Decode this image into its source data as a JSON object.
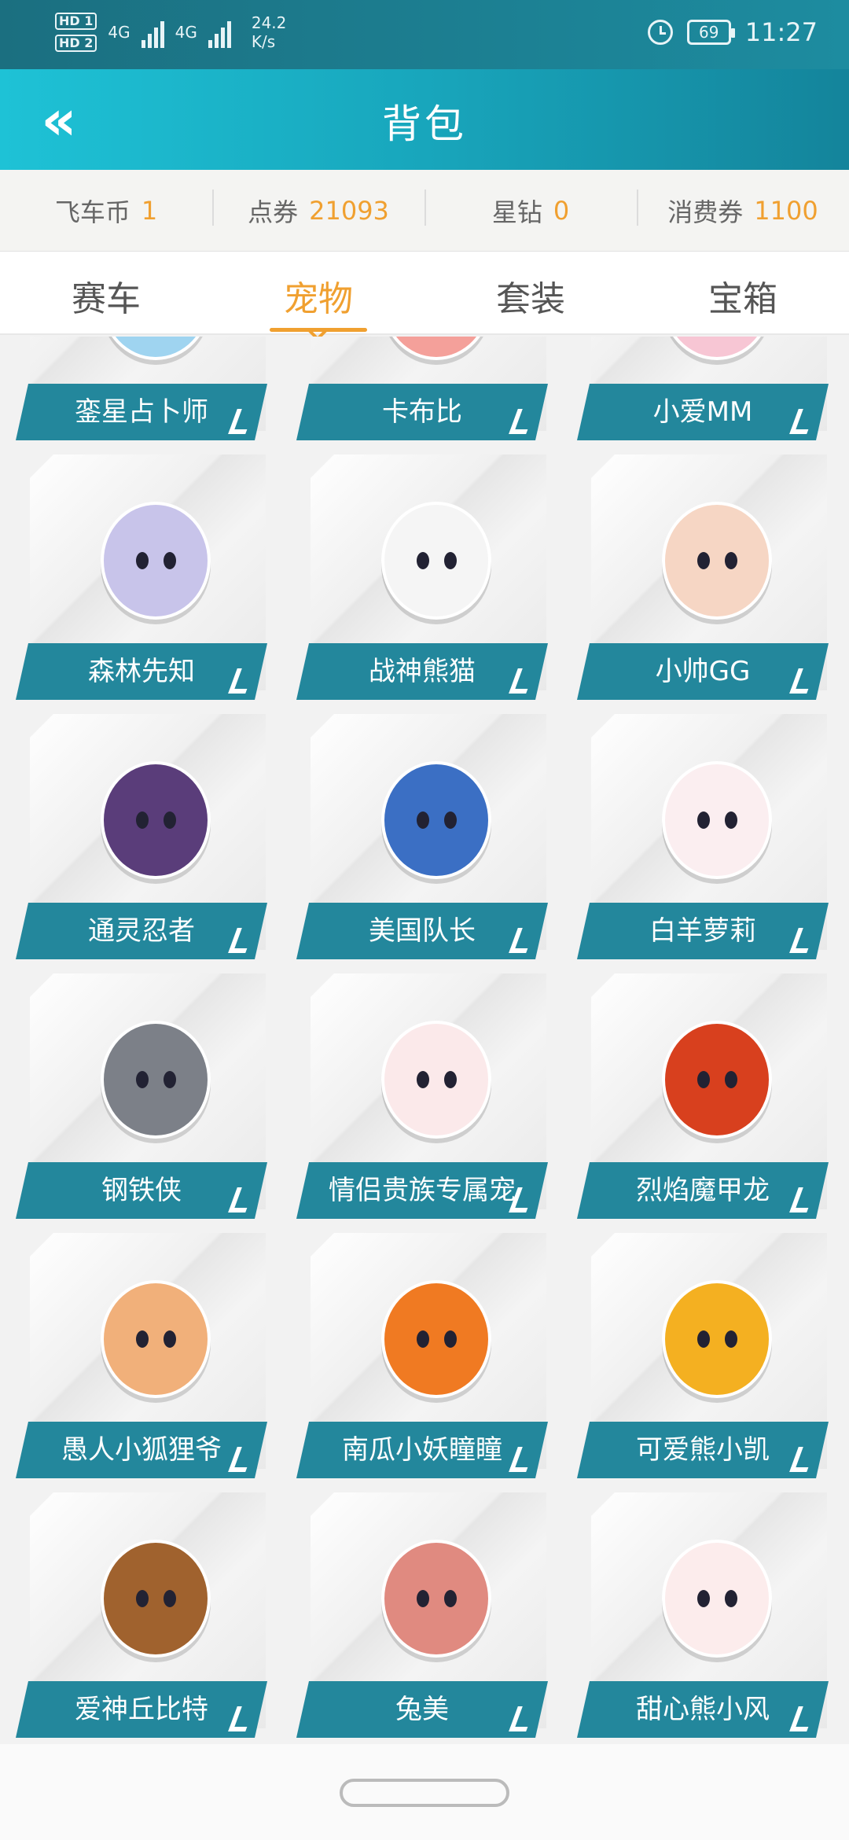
{
  "status": {
    "hd1": "HD 1",
    "hd2": "HD 2",
    "net1": "4G",
    "net2": "4G",
    "speed_value": "24.2",
    "speed_unit": "K/s",
    "battery": "69",
    "time": "11:27"
  },
  "header": {
    "title": "背包",
    "back_icon": "double-chevron-left-icon"
  },
  "currency": [
    {
      "label": "飞车币",
      "value": "1"
    },
    {
      "label": "点券",
      "value": "21093"
    },
    {
      "label": "星钻",
      "value": "0"
    },
    {
      "label": "消费券",
      "value": "1100"
    }
  ],
  "tabs": [
    {
      "label": "赛车",
      "active": false
    },
    {
      "label": "宠物",
      "active": true
    },
    {
      "label": "套装",
      "active": false
    },
    {
      "label": "宝箱",
      "active": false
    }
  ],
  "pets": [
    {
      "name": "銮星占卜师",
      "color": "#9fd4f0"
    },
    {
      "name": "卡布比",
      "color": "#f4a09a"
    },
    {
      "name": "小爱MM",
      "color": "#f7c6d4"
    },
    {
      "name": "森林先知",
      "color": "#c8c4ea"
    },
    {
      "name": "战神熊猫",
      "color": "#f5f5f5"
    },
    {
      "name": "小帅GG",
      "color": "#f6d6c4"
    },
    {
      "name": "通灵忍者",
      "color": "#5a3d7a"
    },
    {
      "name": "美国队长",
      "color": "#3b6fc4"
    },
    {
      "name": "白羊萝莉",
      "color": "#fbeef0"
    },
    {
      "name": "钢铁侠",
      "color": "#7c8088"
    },
    {
      "name": "情侣贵族专属宠",
      "color": "#fbe9ea"
    },
    {
      "name": "烈焰魔甲龙",
      "color": "#d8401e"
    },
    {
      "name": "愚人小狐狸爷",
      "color": "#f1b07a"
    },
    {
      "name": "南瓜小妖瞳瞳",
      "color": "#f07a22"
    },
    {
      "name": "可爱熊小凯",
      "color": "#f4b021"
    },
    {
      "name": "爱神丘比特",
      "color": "#a0622e"
    },
    {
      "name": "兔美",
      "color": "#e08a80"
    },
    {
      "name": "甜心熊小风",
      "color": "#fcecec"
    }
  ]
}
